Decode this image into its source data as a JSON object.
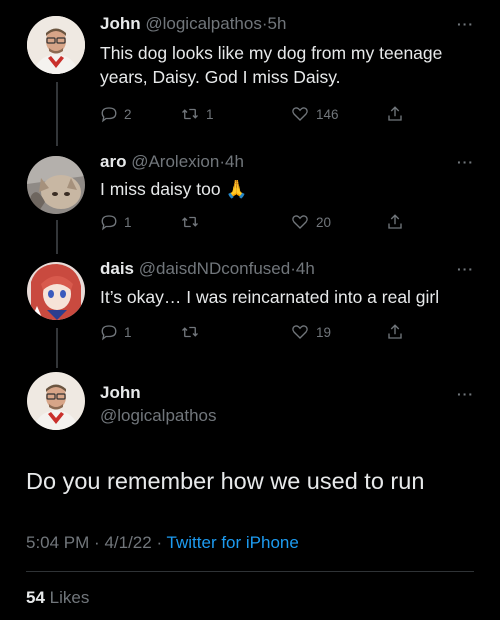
{
  "tweets": [
    {
      "name": "John",
      "handle": "@logicalpathos",
      "time": "5h",
      "text": "This dog looks like my dog from my teenage years, Daisy. God I miss Daisy.",
      "replies": "2",
      "retweets": "1",
      "likes": "146"
    },
    {
      "name": "aro",
      "handle": "@Arolexion",
      "time": "4h",
      "text": "I miss daisy too",
      "emoji": "🙏",
      "replies": "1",
      "retweets": "",
      "likes": "20"
    },
    {
      "name": "dais",
      "handle": "@daisdNDconfused",
      "time": "4h",
      "text": "It’s okay… I was reincarnated into a real girl",
      "replies": "1",
      "retweets": "",
      "likes": "19"
    }
  ],
  "main_tweet": {
    "name": "John",
    "handle": "@logicalpathos",
    "text": "Do you remember how we used to run",
    "time": "5:04 PM",
    "date": "4/1/22",
    "source": "Twitter for iPhone",
    "likes_count": "54",
    "likes_label": "Likes"
  },
  "ui": {
    "more": "···",
    "dot": "·"
  },
  "icons": [
    "reply-icon",
    "retweet-icon",
    "like-icon",
    "share-icon",
    "more-icon"
  ],
  "colors": {
    "background": "#000000",
    "text": "#e7e9ea",
    "muted": "#71767b",
    "link": "#1d9bf0"
  }
}
